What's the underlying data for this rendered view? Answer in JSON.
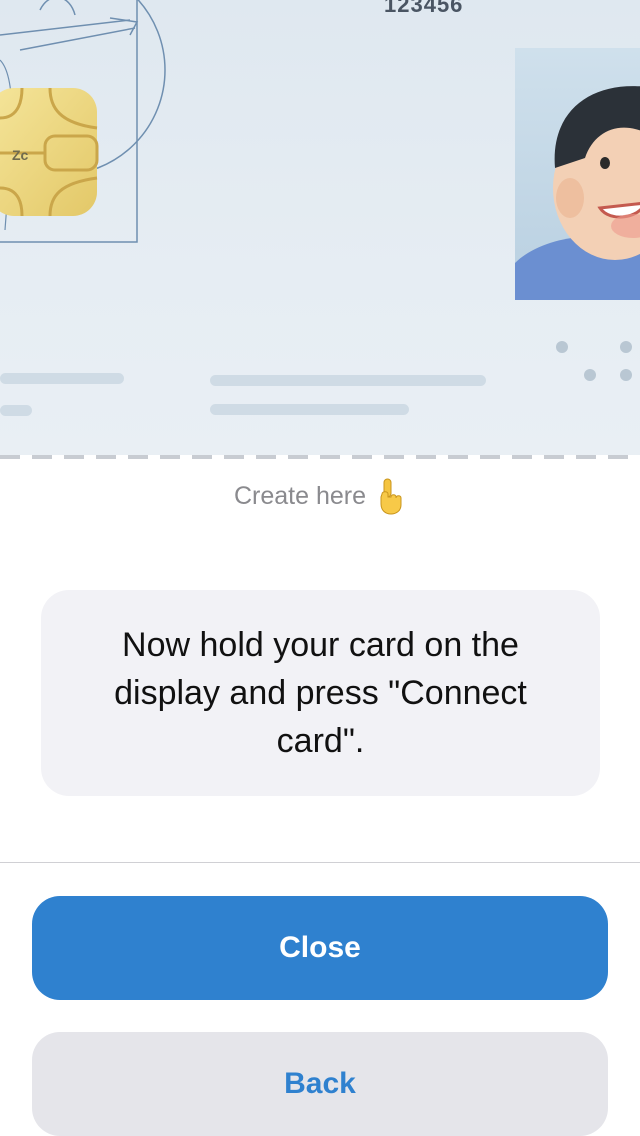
{
  "card": {
    "number": "123456",
    "chip_logo": "Zc",
    "icons": [
      "vitruvian-man-icon",
      "chip-icon",
      "avatar-photo"
    ]
  },
  "hint": {
    "label": "Create here",
    "icon": "pointing-hand-icon"
  },
  "message": {
    "text": "Now hold your card on the display and press \"Connect card\"."
  },
  "buttons": {
    "close_label": "Close",
    "back_label": "Back"
  },
  "colors": {
    "accent": "#2f81cf",
    "secondary_button_bg": "#e5e5ea",
    "message_bg": "#f2f2f6",
    "card_bg": "#e2eaf1"
  }
}
